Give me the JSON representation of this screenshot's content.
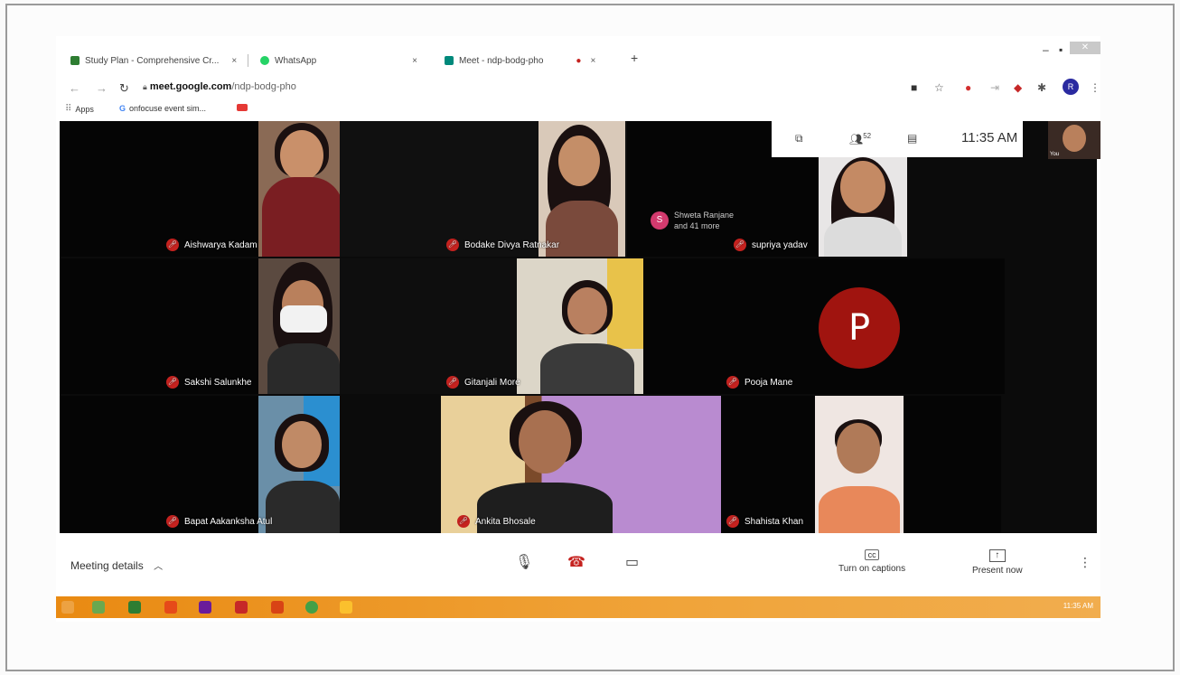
{
  "browser": {
    "tabs": [
      {
        "title": "Study Plan - Comprehensive Cr...",
        "close": "×"
      },
      {
        "title": "WhatsApp",
        "close": "×"
      },
      {
        "title": "Meet - ndp-bodg-pho",
        "close": "×"
      }
    ],
    "new_tab": "+",
    "url_host": "meet.google.com",
    "url_path": "/ndp-bodg-pho",
    "bookmarks": [
      {
        "label": "Apps"
      },
      {
        "label": "onfocuse event sim..."
      }
    ],
    "profile_initial": "R"
  },
  "meet": {
    "participants_top": {
      "initial": "S",
      "line1": "Shweta Ranjane",
      "line2": "and 41 more"
    },
    "participant_count": "52",
    "clock": "11:35 AM",
    "self_label": "You",
    "tiles": [
      {
        "name": "Aishwarya Kadam"
      },
      {
        "name": "Bodake Divya Ratnakar"
      },
      {
        "name": "supriya yadav"
      },
      {
        "name": "Sakshi Salunkhe"
      },
      {
        "name": "Gitanjali More"
      },
      {
        "name": "Pooja Mane",
        "avatar": "P"
      },
      {
        "name": "Bapat Aakanksha Atul"
      },
      {
        "name": "Ankita Bhosale"
      },
      {
        "name": "Shahista Khan"
      }
    ],
    "details_label": "Meeting details",
    "captions_label": "Turn on captions",
    "present_label": "Present now"
  },
  "taskbar": {
    "time": "11:35 AM"
  },
  "colors": {
    "mic_off": "#c5221f",
    "pooja_avatar": "#a0140f",
    "taskbar": "#e98a12"
  }
}
